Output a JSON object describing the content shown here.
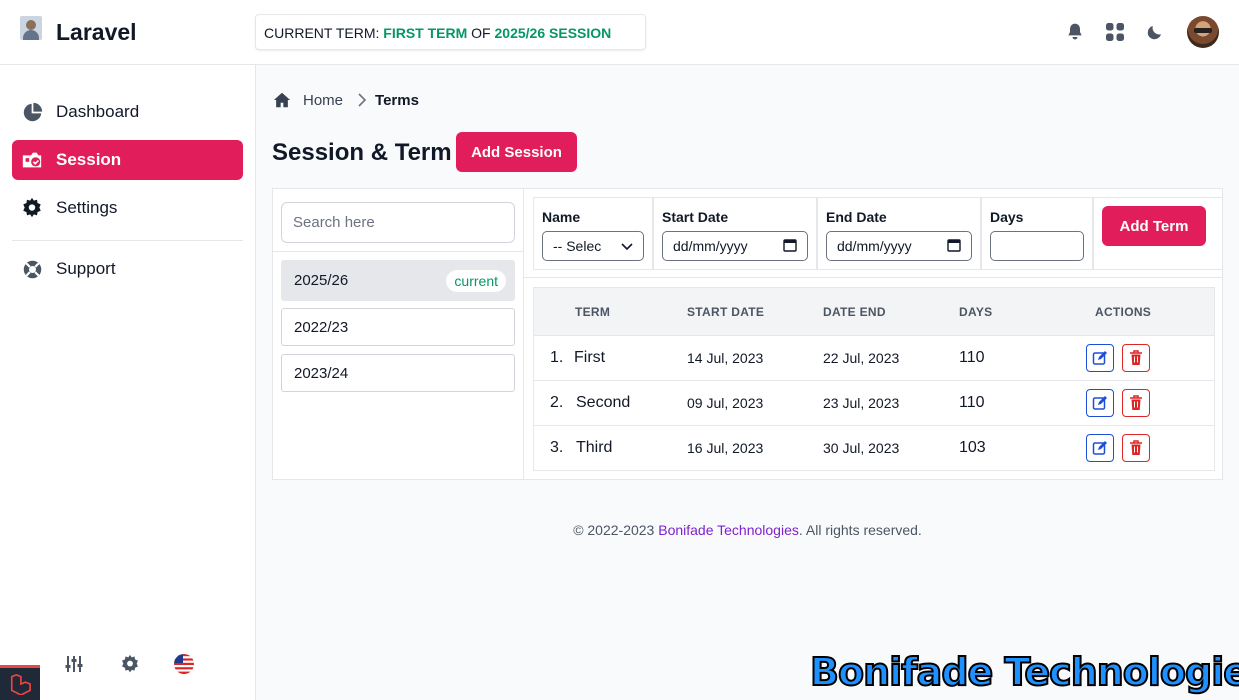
{
  "app": {
    "brand": "Laravel",
    "term_banner": {
      "prefix": "CURRENT TERM: ",
      "term": "FIRST TERM",
      "middle": " OF ",
      "session": "2025/26 SESSION"
    }
  },
  "sidebar": {
    "items": [
      {
        "label": "Dashboard",
        "icon": "pie-chart-icon"
      },
      {
        "label": "Session",
        "icon": "session-icon",
        "active": true
      },
      {
        "label": "Settings",
        "icon": "gear-icon"
      },
      {
        "label": "Support",
        "icon": "lifebuoy-icon"
      }
    ]
  },
  "breadcrumb": {
    "home": "Home",
    "current": "Terms"
  },
  "page": {
    "title": "Session & Term",
    "add_session_label": "Add Session"
  },
  "sessions": {
    "search_placeholder": "Search here",
    "items": [
      {
        "name": "2025/26",
        "badge": "current"
      },
      {
        "name": "2022/23"
      },
      {
        "name": "2023/24"
      }
    ]
  },
  "term_form": {
    "name_label": "Name",
    "name_value": "-- Selec",
    "start_label": "Start Date",
    "start_placeholder": "dd/mm/yyyy",
    "end_label": "End Date",
    "end_placeholder": "dd/mm/yyyy",
    "days_label": "Days",
    "days_value": "",
    "add_term_label": "Add Term"
  },
  "terms_table": {
    "headers": [
      "TERM",
      "START DATE",
      "DATE END",
      "DAYS",
      "ACTIONS"
    ],
    "rows": [
      {
        "num": "1.",
        "term": "First",
        "start": "14 Jul, 2023",
        "end": "22 Jul, 2023",
        "days": "110"
      },
      {
        "num": "2.",
        "term": "Second",
        "start": "09 Jul, 2023",
        "end": "23 Jul, 2023",
        "days": "110"
      },
      {
        "num": "3.",
        "term": "Third",
        "start": "16 Jul, 2023",
        "end": "30 Jul, 2023",
        "days": "103"
      }
    ]
  },
  "footer": {
    "prefix": "© 2022-2023 ",
    "company": "Bonifade Technologies",
    "suffix": ". All rights reserved."
  },
  "watermark": "Bonifade Technologies",
  "colors": {
    "primary": "#e11d5b",
    "accent_green": "#059669",
    "link_purple": "#7e22ce"
  }
}
